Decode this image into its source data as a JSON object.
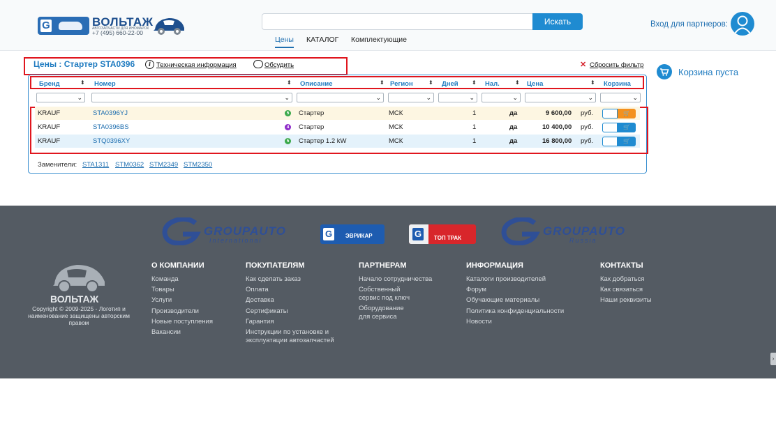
{
  "header": {
    "brand_name": "ВОЛЬТАЖ",
    "brand_tagline": "АВТОЗАПЧАСТИ ДЛЯ ИНОМАРОК",
    "phone": "+7 (495) 660-22-00",
    "search_placeholder": "",
    "search_button": "Искать",
    "tabs": [
      {
        "label": "Цены",
        "active": true
      },
      {
        "label": "КАТАЛОГ",
        "active": false
      },
      {
        "label": "Комплектующие",
        "active": false
      }
    ],
    "partner_login": "Вход для партнеров:"
  },
  "titlebar": {
    "title": "Цены : Стартер STA0396",
    "tech_info": "Техническая информация",
    "discuss": "Обсудить",
    "reset_filter": "Сбросить фильтр"
  },
  "cart": {
    "status": "Корзина пуста"
  },
  "table": {
    "columns": [
      "Бренд",
      "Номер",
      "Описание",
      "Регион",
      "Дней",
      "Нал.",
      "Цена",
      "Корзина"
    ],
    "rows": [
      {
        "brand": "KRAUF",
        "number": "STA0396YJ",
        "badge": "5",
        "badge_color": "#3aa84a",
        "description": "Стартер",
        "region": "МСК",
        "days": "1",
        "stock": "да",
        "price": "9 600,00",
        "currency": "руб.",
        "highlight": "#fdf6e2"
      },
      {
        "brand": "KRAUF",
        "number": "STA0396BS",
        "badge": "4",
        "badge_color": "#8e2bc9",
        "description": "Стартер",
        "region": "МСК",
        "days": "1",
        "stock": "да",
        "price": "10 400,00",
        "currency": "руб.",
        "highlight": "#ffffff"
      },
      {
        "brand": "KRAUF",
        "number": "STQ0396XY",
        "badge": "5",
        "badge_color": "#3aa84a",
        "description": "Стартер 1.2 kW",
        "region": "МСК",
        "days": "1",
        "stock": "да",
        "price": "16 800,00",
        "currency": "руб.",
        "highlight": "#e4f2fb"
      }
    ],
    "replacements_label": "Заменители:",
    "replacements": [
      "STA1311",
      "STM0362",
      "STM2349",
      "STM2350"
    ]
  },
  "footer": {
    "partner_logos": [
      "GROUPAUTO",
      "International",
      "ЭВРИКАР",
      "ТОП ТРАК",
      "GROUPAUTO",
      "Russia"
    ],
    "brand": "ВОЛЬТАЖ",
    "copyright": "Copyright © 2009-2025 - Логотип и наименование защищены авторским правом",
    "columns": [
      {
        "title": "О КОМПАНИИ",
        "items": [
          "Команда",
          "Товары",
          "Услуги",
          "Производители",
          "Новые поступления",
          "Вакансии"
        ]
      },
      {
        "title": "ПОКУПАТЕЛЯМ",
        "items": [
          "Как сделать заказ",
          "Оплата",
          "Доставка",
          "Сертификаты",
          "Гарантия",
          "Инструкции по установке и эксплуатации автозапчастей"
        ]
      },
      {
        "title": "ПАРТНЕРАМ",
        "items": [
          "Начало сотрудничества",
          "Собственный сервис под ключ",
          "Оборудование для сервиса"
        ]
      },
      {
        "title": "ИНФОРМАЦИЯ",
        "items": [
          "Каталоги производителей",
          "Форум",
          "Обучающие материалы",
          "Политика конфиденциальности",
          "Новости"
        ]
      },
      {
        "title": "КОНТАКТЫ",
        "items": [
          "Как добраться",
          "Как связаться",
          "Наши реквизиты"
        ]
      }
    ]
  },
  "colors": {
    "accent": "#1f8bd1",
    "highlight_border": "#e0161e",
    "footer_bg": "#545b63"
  }
}
